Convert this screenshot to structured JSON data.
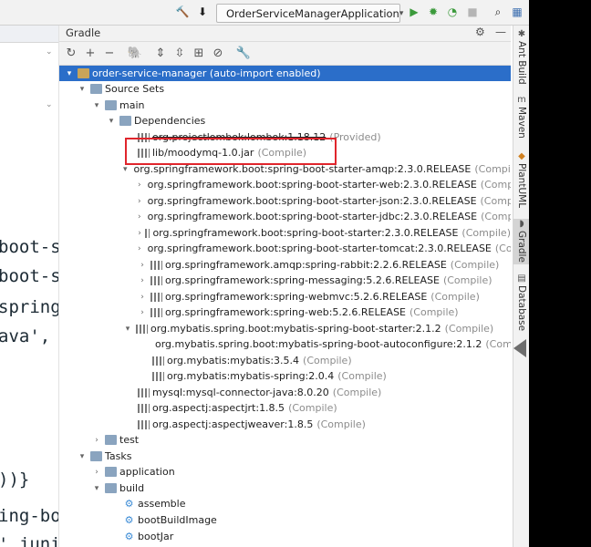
{
  "toolbar": {
    "run_config": "OrderServiceManagerApplication"
  },
  "editor": {
    "code_lines": [
      "boot-s",
      "boot-s",
      "spring",
      "ava',",
      "))}",
      "ing-bo",
      "' junit"
    ]
  },
  "gradle": {
    "title": "Gradle",
    "tree": [
      {
        "label": "order-service-manager (auto-import enabled)",
        "scope": ""
      },
      {
        "label": "Source Sets",
        "scope": ""
      },
      {
        "label": "main",
        "scope": ""
      },
      {
        "label": "Dependencies",
        "scope": ""
      },
      {
        "label": "org.projectlombok:lombok:1.18.12",
        "scope": "(Provided)"
      },
      {
        "label": "lib/moodymq-1.0.jar",
        "scope": "(Compile)"
      },
      {
        "label": "org.springframework.boot:spring-boot-starter-amqp:2.3.0.RELEASE",
        "scope": "(Compile)"
      },
      {
        "label": "org.springframework.boot:spring-boot-starter-web:2.3.0.RELEASE",
        "scope": "(Compile)"
      },
      {
        "label": "org.springframework.boot:spring-boot-starter-json:2.3.0.RELEASE",
        "scope": "(Compile)"
      },
      {
        "label": "org.springframework.boot:spring-boot-starter-jdbc:2.3.0.RELEASE",
        "scope": "(Compile)"
      },
      {
        "label": "org.springframework.boot:spring-boot-starter:2.3.0.RELEASE",
        "scope": "(Compile)"
      },
      {
        "label": "org.springframework.boot:spring-boot-starter-tomcat:2.3.0.RELEASE",
        "scope": "(Compile)"
      },
      {
        "label": "org.springframework.amqp:spring-rabbit:2.2.6.RELEASE",
        "scope": "(Compile)"
      },
      {
        "label": "org.springframework:spring-messaging:5.2.6.RELEASE",
        "scope": "(Compile)"
      },
      {
        "label": "org.springframework:spring-webmvc:5.2.6.RELEASE",
        "scope": "(Compile)"
      },
      {
        "label": "org.springframework:spring-web:5.2.6.RELEASE",
        "scope": "(Compile)"
      },
      {
        "label": "org.mybatis.spring.boot:mybatis-spring-boot-starter:2.1.2",
        "scope": "(Compile)"
      },
      {
        "label": "org.mybatis.spring.boot:mybatis-spring-boot-autoconfigure:2.1.2",
        "scope": "(Compile)"
      },
      {
        "label": "org.mybatis:mybatis:3.5.4",
        "scope": "(Compile)"
      },
      {
        "label": "org.mybatis:mybatis-spring:2.0.4",
        "scope": "(Compile)"
      },
      {
        "label": "mysql:mysql-connector-java:8.0.20",
        "scope": "(Compile)"
      },
      {
        "label": "org.aspectj:aspectjrt:1.8.5",
        "scope": "(Compile)"
      },
      {
        "label": "org.aspectj:aspectjweaver:1.8.5",
        "scope": "(Compile)"
      },
      {
        "label": "test",
        "scope": ""
      },
      {
        "label": "Tasks",
        "scope": ""
      },
      {
        "label": "application",
        "scope": ""
      },
      {
        "label": "build",
        "scope": ""
      },
      {
        "label": "assemble",
        "scope": ""
      },
      {
        "label": "bootBuildImage",
        "scope": ""
      },
      {
        "label": "bootJar",
        "scope": ""
      }
    ]
  },
  "side_tabs": [
    "Ant Build",
    "Maven",
    "PlantUML",
    "Gradle",
    "Database"
  ],
  "colors": {
    "selection": "#2b6ec9",
    "highlight_box": "#e0252c"
  }
}
